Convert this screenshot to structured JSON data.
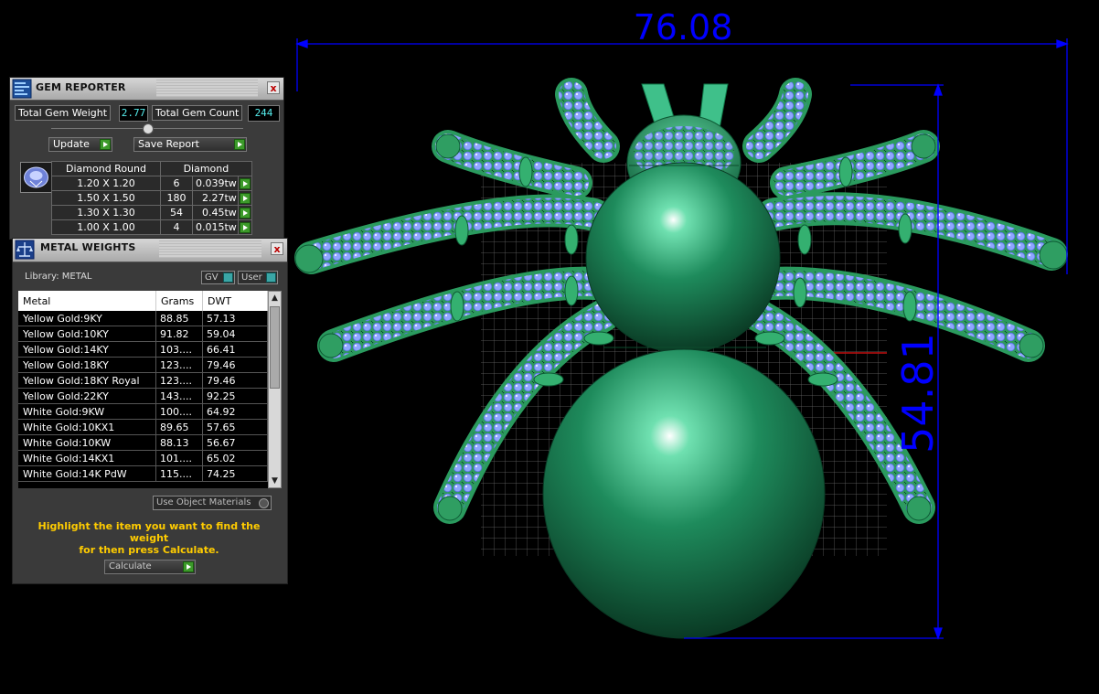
{
  "dimensions": {
    "width_label": "76.08",
    "height_label": "54.81"
  },
  "colors": {
    "dimension": "#0000ff",
    "gem": "#8ea6ff",
    "metal": "#1f8a5a",
    "accent_value": "#55eeee",
    "hint": "#ffcc00"
  },
  "gem_reporter": {
    "title": "GEM REPORTER",
    "close": "x",
    "total_weight_label": "Total Gem Weight",
    "total_weight_value": "2.77",
    "total_count_label": "Total Gem Count",
    "total_count_value": "244",
    "update_label": "Update",
    "save_report_label": "Save Report",
    "table": {
      "headers": [
        "Diamond Round",
        "Diamond"
      ],
      "rows": [
        {
          "size": "1.20 X 1.20",
          "count": "6",
          "weight": "0.039tw"
        },
        {
          "size": "1.50 X 1.50",
          "count": "180",
          "weight": "2.27tw"
        },
        {
          "size": "1.30 X 1.30",
          "count": "54",
          "weight": "0.45tw"
        },
        {
          "size": "1.00 X 1.00",
          "count": "4",
          "weight": "0.015tw"
        }
      ]
    }
  },
  "metal_weights": {
    "title": "METAL WEIGHTS",
    "close": "x",
    "library_label": "Library: METAL",
    "gv_label": "GV",
    "user_label": "User",
    "headers": [
      "Metal",
      "Grams",
      "DWT"
    ],
    "rows": [
      {
        "metal": "Yellow Gold:9KY",
        "grams": "88.85",
        "dwt": "57.13"
      },
      {
        "metal": "Yellow Gold:10KY",
        "grams": "91.82",
        "dwt": "59.04"
      },
      {
        "metal": "Yellow Gold:14KY",
        "grams": "103....",
        "dwt": "66.41"
      },
      {
        "metal": "Yellow Gold:18KY",
        "grams": "123....",
        "dwt": "79.46"
      },
      {
        "metal": "Yellow Gold:18KY Royal",
        "grams": "123....",
        "dwt": "79.46"
      },
      {
        "metal": "Yellow Gold:22KY",
        "grams": "143....",
        "dwt": "92.25"
      },
      {
        "metal": "White Gold:9KW",
        "grams": "100....",
        "dwt": "64.92"
      },
      {
        "metal": "White Gold:10KX1",
        "grams": "89.65",
        "dwt": "57.65"
      },
      {
        "metal": "White Gold:10KW",
        "grams": "88.13",
        "dwt": "56.67"
      },
      {
        "metal": "White Gold:14KX1",
        "grams": "101....",
        "dwt": "65.02"
      },
      {
        "metal": "White Gold:14K PdW",
        "grams": "115....",
        "dwt": "74.25"
      }
    ],
    "use_object_materials_label": "Use Object Materials",
    "hint_line1": "Highlight the item you want to find the weight",
    "hint_line2": "for then press Calculate.",
    "calculate_label": "Calculate"
  }
}
